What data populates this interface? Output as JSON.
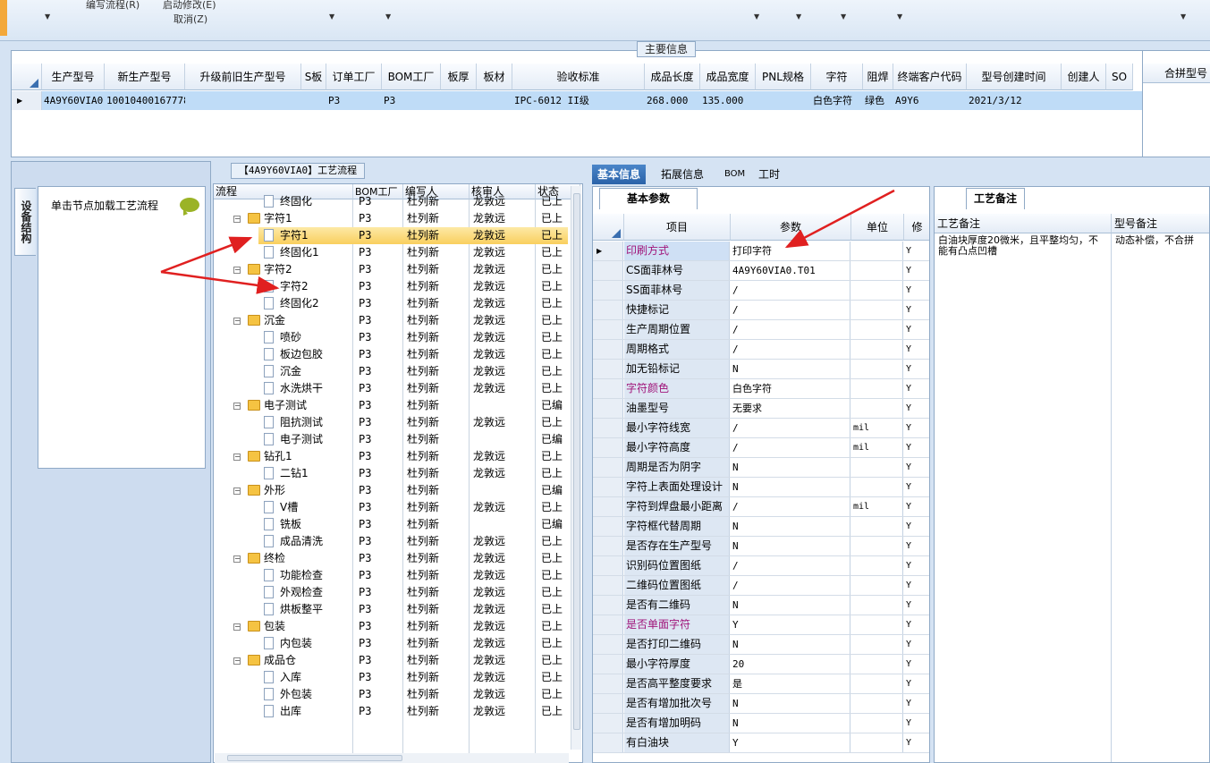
{
  "toolbar": {
    "item1": "编写流程(R)",
    "item2": "启动修改(E)",
    "item3": "取消(Z)"
  },
  "main_info": {
    "title": "主要信息",
    "columns": [
      "生产型号",
      "新生产型号",
      "升级前旧生产型号",
      "S板",
      "订单工厂",
      "BOM工厂",
      "板厚",
      "板材",
      "验收标准",
      "成品长度",
      "成品宽度",
      "PNL规格",
      "字符",
      "阻焊",
      "终端客户代码",
      "型号创建时间",
      "创建人",
      "SO"
    ],
    "row": [
      "4A9Y60VIA0",
      "10010400167778",
      "",
      "",
      "P3",
      "P3",
      "",
      "",
      "IPC-6012 II级",
      "268.000",
      "135.000",
      "",
      "白色字符",
      "绿色",
      "A9Y6",
      "2021/3/12",
      "",
      ""
    ],
    "side_header": "合拼型号"
  },
  "left_panel": {
    "vertical_tab": "设备结构",
    "node_hint": "单击节点加载工艺流程"
  },
  "tree": {
    "title": "【4A9Y60VIA0】工艺流程",
    "columns": [
      "流程",
      "BOM工厂",
      "编写人",
      "核审人",
      "状态"
    ],
    "rows": [
      {
        "name": "终固化",
        "level": 2,
        "type": "doc",
        "bom": "P3",
        "author": "杜列新",
        "reviewer": "龙敦远",
        "status": "已上 ",
        "partial": true
      },
      {
        "name": "字符1",
        "level": 1,
        "type": "folder",
        "bom": "P3",
        "author": "杜列新",
        "reviewer": "龙敦远",
        "status": "已上 "
      },
      {
        "name": "字符1",
        "level": 2,
        "type": "doc",
        "bom": "P3",
        "author": "杜列新",
        "reviewer": "龙敦远",
        "status": "已上 ",
        "selected": true
      },
      {
        "name": "终固化1",
        "level": 2,
        "type": "doc",
        "bom": "P3",
        "author": "杜列新",
        "reviewer": "龙敦远",
        "status": "已上 "
      },
      {
        "name": "字符2",
        "level": 1,
        "type": "folder",
        "bom": "P3",
        "author": "杜列新",
        "reviewer": "龙敦远",
        "status": "已上 "
      },
      {
        "name": "字符2",
        "level": 2,
        "type": "doc",
        "bom": "P3",
        "author": "杜列新",
        "reviewer": "龙敦远",
        "status": "已上 "
      },
      {
        "name": "终固化2",
        "level": 2,
        "type": "doc",
        "bom": "P3",
        "author": "杜列新",
        "reviewer": "龙敦远",
        "status": "已上 "
      },
      {
        "name": "沉金",
        "level": 1,
        "type": "folder",
        "bom": "P3",
        "author": "杜列新",
        "reviewer": "龙敦远",
        "status": "已上 "
      },
      {
        "name": "喷砂",
        "level": 2,
        "type": "doc",
        "bom": "P3",
        "author": "杜列新",
        "reviewer": "龙敦远",
        "status": "已上 "
      },
      {
        "name": "板边包胶",
        "level": 2,
        "type": "doc",
        "bom": "P3",
        "author": "杜列新",
        "reviewer": "龙敦远",
        "status": "已上 "
      },
      {
        "name": "沉金",
        "level": 2,
        "type": "doc",
        "bom": "P3",
        "author": "杜列新",
        "reviewer": "龙敦远",
        "status": "已上 "
      },
      {
        "name": "水洗烘干",
        "level": 2,
        "type": "doc",
        "bom": "P3",
        "author": "杜列新",
        "reviewer": "龙敦远",
        "status": "已上 "
      },
      {
        "name": "电子测试",
        "level": 1,
        "type": "folder",
        "bom": "P3",
        "author": "杜列新",
        "reviewer": "",
        "status": "已编 "
      },
      {
        "name": "阻抗测试",
        "level": 2,
        "type": "doc",
        "bom": "P3",
        "author": "杜列新",
        "reviewer": "龙敦远",
        "status": "已上 "
      },
      {
        "name": "电子测试",
        "level": 2,
        "type": "doc",
        "bom": "P3",
        "author": "杜列新",
        "reviewer": "",
        "status": "已编 "
      },
      {
        "name": "钻孔1",
        "level": 1,
        "type": "folder",
        "bom": "P3",
        "author": "杜列新",
        "reviewer": "龙敦远",
        "status": "已上 "
      },
      {
        "name": "二钻1",
        "level": 2,
        "type": "doc",
        "bom": "P3",
        "author": "杜列新",
        "reviewer": "龙敦远",
        "status": "已上 "
      },
      {
        "name": "外形",
        "level": 1,
        "type": "folder",
        "bom": "P3",
        "author": "杜列新",
        "reviewer": "",
        "status": "已编 "
      },
      {
        "name": "V槽",
        "level": 2,
        "type": "doc",
        "bom": "P3",
        "author": "杜列新",
        "reviewer": "龙敦远",
        "status": "已上 "
      },
      {
        "name": "铣板",
        "level": 2,
        "type": "doc",
        "bom": "P3",
        "author": "杜列新",
        "reviewer": "",
        "status": "已编 "
      },
      {
        "name": "成品清洗",
        "level": 2,
        "type": "doc",
        "bom": "P3",
        "author": "杜列新",
        "reviewer": "龙敦远",
        "status": "已上 "
      },
      {
        "name": "终检",
        "level": 1,
        "type": "folder",
        "bom": "P3",
        "author": "杜列新",
        "reviewer": "龙敦远",
        "status": "已上 "
      },
      {
        "name": "功能检查",
        "level": 2,
        "type": "doc",
        "bom": "P3",
        "author": "杜列新",
        "reviewer": "龙敦远",
        "status": "已上 "
      },
      {
        "name": "外观检查",
        "level": 2,
        "type": "doc",
        "bom": "P3",
        "author": "杜列新",
        "reviewer": "龙敦远",
        "status": "已上 "
      },
      {
        "name": "烘板整平",
        "level": 2,
        "type": "doc",
        "bom": "P3",
        "author": "杜列新",
        "reviewer": "龙敦远",
        "status": "已上 "
      },
      {
        "name": "包装",
        "level": 1,
        "type": "folder",
        "bom": "P3",
        "author": "杜列新",
        "reviewer": "龙敦远",
        "status": "已上 "
      },
      {
        "name": "内包装",
        "level": 2,
        "type": "doc",
        "bom": "P3",
        "author": "杜列新",
        "reviewer": "龙敦远",
        "status": "已上 "
      },
      {
        "name": "成品仓",
        "level": 1,
        "type": "folder",
        "bom": "P3",
        "author": "杜列新",
        "reviewer": "龙敦远",
        "status": "已上 "
      },
      {
        "name": "入库",
        "level": 2,
        "type": "doc",
        "bom": "P3",
        "author": "杜列新",
        "reviewer": "龙敦远",
        "status": "已上 "
      },
      {
        "name": "外包装",
        "level": 2,
        "type": "doc",
        "bom": "P3",
        "author": "杜列新",
        "reviewer": "龙敦远",
        "status": "已上 "
      },
      {
        "name": "出库",
        "level": 2,
        "type": "doc",
        "bom": "P3",
        "author": "杜列新",
        "reviewer": "龙敦远",
        "status": "已上 "
      }
    ]
  },
  "tabs": [
    "基本信息",
    "拓展信息",
    "BOM",
    "工时"
  ],
  "params": {
    "tab": "基本参数",
    "columns": [
      "项目",
      "参数",
      "单位",
      "修"
    ],
    "rows": [
      {
        "name": "印刷方式",
        "value": "打印字符",
        "unit": "",
        "flag": "Y",
        "hl": true,
        "cur": true
      },
      {
        "name": "CS面菲林号",
        "value": "4A9Y60VIA0.T01",
        "unit": "",
        "flag": "Y"
      },
      {
        "name": "SS面菲林号",
        "value": "/",
        "unit": "",
        "flag": "Y"
      },
      {
        "name": "快捷标记",
        "value": "/",
        "unit": "",
        "flag": "Y"
      },
      {
        "name": "生产周期位置",
        "value": "/",
        "unit": "",
        "flag": "Y"
      },
      {
        "name": "周期格式",
        "value": "/",
        "unit": "",
        "flag": "Y"
      },
      {
        "name": "加无铅标记",
        "value": "N",
        "unit": "",
        "flag": "Y"
      },
      {
        "name": "字符颜色",
        "value": "白色字符",
        "unit": "",
        "flag": "Y",
        "hl": true
      },
      {
        "name": "油墨型号",
        "value": "无要求",
        "unit": "",
        "flag": "Y"
      },
      {
        "name": "最小字符线宽",
        "value": "/",
        "unit": "mil",
        "flag": "Y"
      },
      {
        "name": "最小字符高度",
        "value": "/",
        "unit": "mil",
        "flag": "Y"
      },
      {
        "name": "周期是否为阴字",
        "value": "N",
        "unit": "",
        "flag": "Y"
      },
      {
        "name": "字符上表面处理设计",
        "value": "N",
        "unit": "",
        "flag": "Y"
      },
      {
        "name": "字符到焊盘最小距离",
        "value": "/",
        "unit": "mil",
        "flag": "Y"
      },
      {
        "name": "字符框代替周期",
        "value": "N",
        "unit": "",
        "flag": "Y"
      },
      {
        "name": "是否存在生产型号",
        "value": "N",
        "unit": "",
        "flag": "Y"
      },
      {
        "name": "识别码位置图纸",
        "value": "/",
        "unit": "",
        "flag": "Y"
      },
      {
        "name": "二维码位置图纸",
        "value": "/",
        "unit": "",
        "flag": "Y"
      },
      {
        "name": "是否有二维码",
        "value": "N",
        "unit": "",
        "flag": "Y"
      },
      {
        "name": "是否单面字符",
        "value": "Y",
        "unit": "",
        "flag": "Y",
        "hl": true
      },
      {
        "name": "是否打印二维码",
        "value": "N",
        "unit": "",
        "flag": "Y"
      },
      {
        "name": "最小字符厚度",
        "value": "20",
        "unit": "",
        "flag": "Y"
      },
      {
        "name": "是否高平整度要求",
        "value": "是",
        "unit": "",
        "flag": "Y"
      },
      {
        "name": "是否有增加批次号",
        "value": "N",
        "unit": "",
        "flag": "Y"
      },
      {
        "name": "是否有增加明码",
        "value": "N",
        "unit": "",
        "flag": "Y"
      },
      {
        "name": "有白油块",
        "value": "Y",
        "unit": "",
        "flag": "Y"
      }
    ]
  },
  "notes": {
    "tab": "工艺备注",
    "col1": "工艺备注",
    "col2": "型号备注",
    "note1": "白油块厚度20微米，且平整均匀，不能有凸点凹槽",
    "note2": "动态补偿，不合拼"
  },
  "colors": {
    "accent": "#2a62a8",
    "selection": "#bfdcf7",
    "highlight_text": "#a0147a",
    "arrow": "#e02020"
  }
}
